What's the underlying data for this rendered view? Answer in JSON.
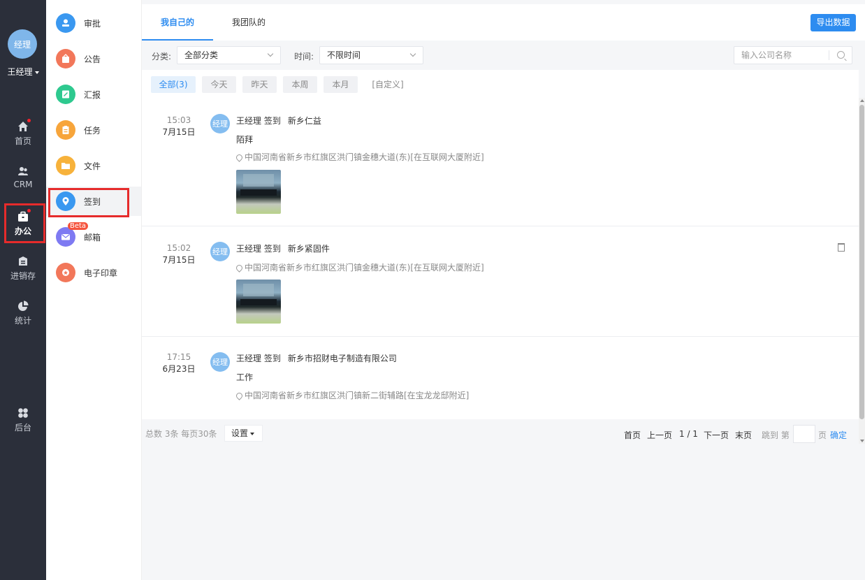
{
  "user": {
    "avatar_text": "经理",
    "name": "王经理"
  },
  "rail": {
    "items": [
      {
        "label": "首页",
        "icon": "home-icon",
        "badge": true
      },
      {
        "label": "CRM",
        "icon": "crm-icon",
        "badge": false
      },
      {
        "label": "办公",
        "icon": "office-icon",
        "badge": true,
        "active": true
      },
      {
        "label": "进销存",
        "icon": "inventory-icon",
        "badge": false
      },
      {
        "label": "统计",
        "icon": "pie-chart-icon",
        "badge": false
      },
      {
        "label": "后台",
        "icon": "admin-grid-icon",
        "badge": false
      }
    ]
  },
  "modules": {
    "items": [
      {
        "label": "审批",
        "icon": "approval-icon",
        "color": "#3a98f0"
      },
      {
        "label": "公告",
        "icon": "announcement-icon",
        "color": "#f2775a"
      },
      {
        "label": "汇报",
        "icon": "report-icon",
        "color": "#2ec98f"
      },
      {
        "label": "任务",
        "icon": "task-icon",
        "color": "#f7a53b"
      },
      {
        "label": "文件",
        "icon": "folder-icon",
        "color": "#f7b23b"
      },
      {
        "label": "签到",
        "icon": "checkin-icon",
        "color": "#3a98f0",
        "active": true
      },
      {
        "label": "邮箱",
        "icon": "mail-icon",
        "color": "#7e7af2",
        "beta": "Beta"
      },
      {
        "label": "电子印章",
        "icon": "seal-icon",
        "color": "#f2775a"
      }
    ]
  },
  "tabs": [
    {
      "label": "我自己的",
      "active": true
    },
    {
      "label": "我团队的"
    }
  ],
  "export_label": "导出数据",
  "filters": {
    "category_label": "分类:",
    "category_value": "全部分类",
    "time_label": "时间:",
    "time_value": "不限时间",
    "search_placeholder": "输入公司名称"
  },
  "chips": [
    {
      "label": "全部(3)",
      "active": true
    },
    {
      "label": "今天"
    },
    {
      "label": "昨天"
    },
    {
      "label": "本周"
    },
    {
      "label": "本月"
    },
    {
      "label": "[自定义]"
    }
  ],
  "records": [
    {
      "time": "15:03",
      "date": "7月15日",
      "avatar": "经理",
      "user_action": "王经理 签到",
      "place": "新乡仁益",
      "note": "陌拜",
      "address": "中国河南省新乡市红旗区洪门镇金穗大道(东)[在互联网大厦附近]",
      "has_photo": true,
      "has_delete": false
    },
    {
      "time": "15:02",
      "date": "7月15日",
      "avatar": "经理",
      "user_action": "王经理 签到",
      "place": "新乡紧固件",
      "note": "",
      "address": "中国河南省新乡市红旗区洪门镇金穗大道(东)[在互联网大厦附近]",
      "has_photo": true,
      "has_delete": true
    },
    {
      "time": "17:15",
      "date": "6月23日",
      "avatar": "经理",
      "user_action": "王经理 签到",
      "place": "新乡市招财电子制造有限公司",
      "note": "工作",
      "address": "中国河南省新乡市红旗区洪门镇新二街辅路[在宝龙龙邸附近]",
      "has_photo": false,
      "has_delete": false
    }
  ],
  "pager": {
    "summary": "总数 3条 每页30条",
    "settings": "设置",
    "first": "首页",
    "prev": "上一页",
    "page": "1 / 1",
    "next": "下一页",
    "last": "末页",
    "jump_to": "跳到 第",
    "page_unit": "页",
    "confirm": "确定"
  }
}
